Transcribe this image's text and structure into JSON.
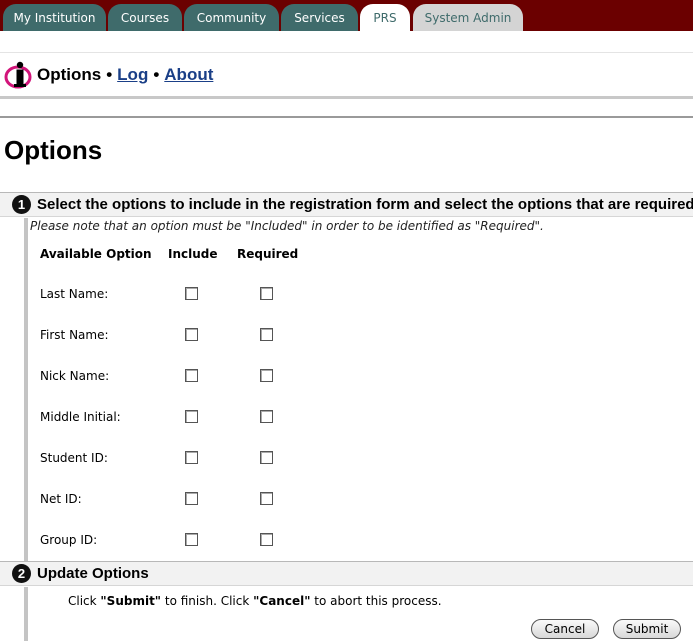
{
  "tabs": [
    {
      "label": "My Institution"
    },
    {
      "label": "Courses"
    },
    {
      "label": "Community"
    },
    {
      "label": "Services"
    },
    {
      "label": "PRS"
    },
    {
      "label": "System Admin"
    }
  ],
  "tool_header": {
    "title": "Options",
    "separator": "•",
    "links": [
      "Log",
      "About"
    ]
  },
  "page_title": "Options",
  "step1": {
    "number": "1",
    "title": "Select the options to include in the registration form and select the options that are required",
    "note": "Please note that an option must be \"Included\" in order to be identified as \"Required\".",
    "columns": [
      "Available Option",
      "Include",
      "Required"
    ],
    "options": [
      {
        "label": "Last Name:",
        "include": false,
        "required": false
      },
      {
        "label": "First Name:",
        "include": false,
        "required": false
      },
      {
        "label": "Nick Name:",
        "include": false,
        "required": false
      },
      {
        "label": "Middle Initial:",
        "include": false,
        "required": false
      },
      {
        "label": "Student ID:",
        "include": false,
        "required": false
      },
      {
        "label": "Net ID:",
        "include": false,
        "required": false
      },
      {
        "label": "Group ID:",
        "include": false,
        "required": false
      }
    ]
  },
  "step2": {
    "number": "2",
    "title": "Update Options",
    "instruction": {
      "p1": "Click ",
      "submit": "\"Submit\"",
      "p2": " to finish. Click ",
      "cancel": "\"Cancel\"",
      "p3": " to abort this process."
    }
  },
  "buttons": {
    "cancel": "Cancel",
    "submit": "Submit"
  },
  "colors": {
    "tab_bar": "#6b0000",
    "tab": "#3f6b6b",
    "link": "#1a3f87"
  }
}
